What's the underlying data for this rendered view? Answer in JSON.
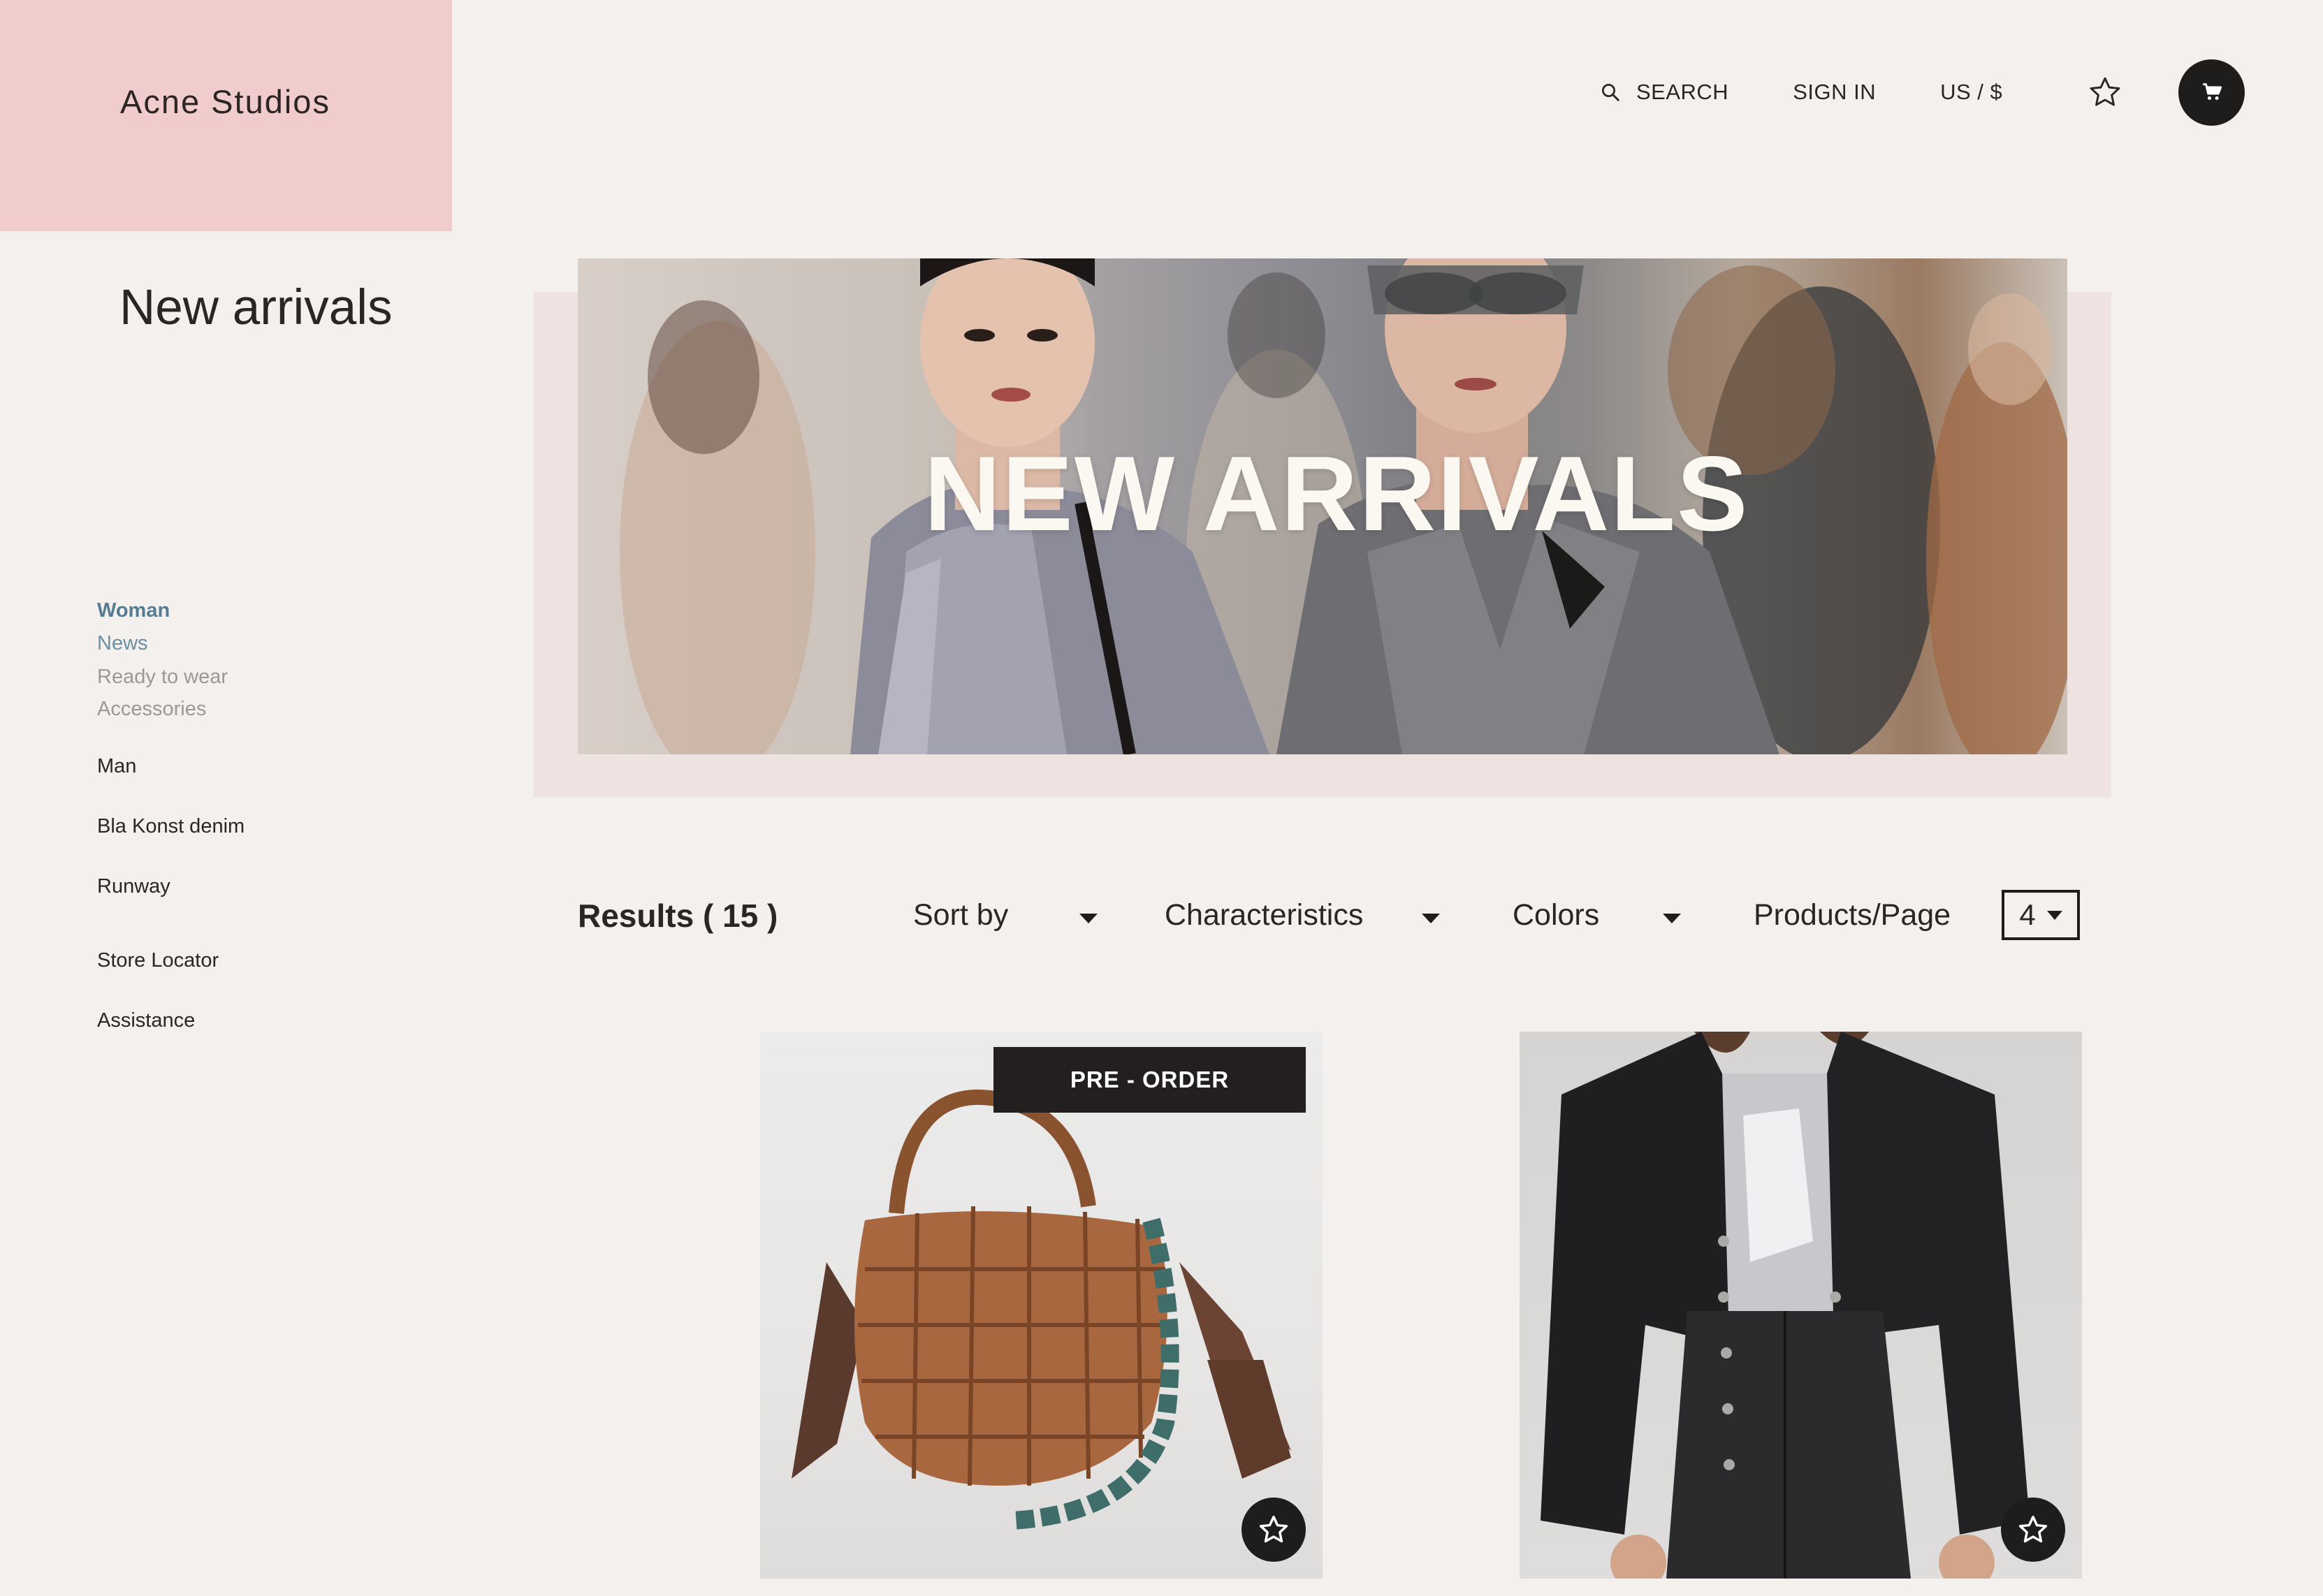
{
  "brand": {
    "logo_text": "Acne Studios",
    "logo_bg": "#f0cccc"
  },
  "header": {
    "search_label": "SEARCH",
    "signin_label": "SIGN IN",
    "region_label": "US / $",
    "icons": [
      "search-icon",
      "star-icon",
      "cart-icon"
    ]
  },
  "page": {
    "title": "New arrivals"
  },
  "sidebar": {
    "category": "Woman",
    "subitems": [
      "News",
      "Ready to wear",
      "Accessories"
    ],
    "items": [
      "Man",
      "Bla Konst denim",
      "Runway",
      "Store Locator",
      "Assistance"
    ]
  },
  "hero": {
    "title": "NEW ARRIVALS"
  },
  "filters": {
    "results": "Results ( 15 )",
    "sort_by": "Sort by",
    "characteristics": "Characteristics",
    "colors": "Colors",
    "products_per_page": "Products/Page",
    "products_per_page_value": "4"
  },
  "products": [
    {
      "badge": "PRE - ORDER",
      "image": "quilted brown leather bag with green chain strap"
    },
    {
      "image": "black leather jacket over silver top"
    }
  ],
  "colors": {
    "background": "#f4f0ed",
    "accent_blue": "#567c91",
    "dark": "#1f1d1c",
    "hero_frame": "#efe3e2"
  }
}
